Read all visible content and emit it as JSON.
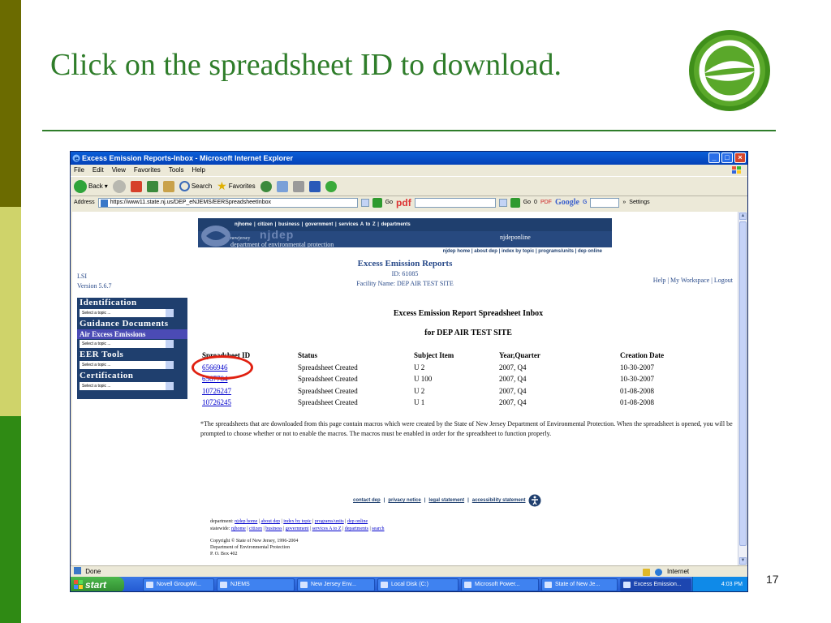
{
  "slide": {
    "title": "Click on the spreadsheet ID to download.",
    "number": "17"
  },
  "window": {
    "title": "Excess Emission Reports-Inbox - Microsoft Internet Explorer",
    "menu": [
      "File",
      "Edit",
      "View",
      "Favorites",
      "Tools",
      "Help"
    ],
    "toolbar": {
      "back": "Back",
      "search": "Search",
      "favorites": "Favorites"
    },
    "address": {
      "label": "Address",
      "url": "https://www11.state.nj.us/DEP_eNJEMS/EERSpreadsheetInbox",
      "go": "Go",
      "pdf_word": "pdf",
      "go2": "Go",
      "zero": "0",
      "pdf_btn": "PDF",
      "google": "Google",
      "google_g": "G",
      "settings": "Settings"
    },
    "status": {
      "done": "Done",
      "zone": "Internet"
    }
  },
  "page": {
    "banner": {
      "top_links": "njhome | citizen | business | government | services A to Z | departments",
      "newjersey": "newjersey",
      "njdep": "njdep",
      "dept": "department of environmental protection",
      "online": "njdeponline",
      "bottom_links": "njdep home | about dep | index by topic | programs/units | dep online"
    },
    "app_title": "Excess Emission Reports",
    "id_line": "ID: 61085",
    "facility_line": "Facility Name: DEP AIR TEST SITE",
    "lsi": "LSI",
    "version": "Version 5.6.7",
    "top_links": {
      "help": "Help",
      "workspace": "My Workspace",
      "logout": "Logout"
    },
    "nav": {
      "identification": "Identification",
      "guidance": "Guidance Documents",
      "air_excess": "Air Excess Emissions",
      "eer_tools": "EER Tools",
      "certification": "Certification",
      "select_placeholder": "Select a topic ..."
    },
    "inbox_title": "Excess Emission Report Spreadsheet Inbox",
    "inbox_subtitle": "for DEP AIR TEST SITE",
    "table": {
      "headers": [
        "Spreadsheet ID",
        "Status",
        "Subject Item",
        "Year,Quarter",
        "Creation Date"
      ],
      "rows": [
        {
          "id": "6566946",
          "status": "Spreadsheet Created",
          "subject": "U 2",
          "yq": "2007, Q4",
          "date": "10-30-2007"
        },
        {
          "id": "6567784",
          "status": "Spreadsheet Created",
          "subject": "U 100",
          "yq": "2007, Q4",
          "date": "10-30-2007"
        },
        {
          "id": "10726247",
          "status": "Spreadsheet Created",
          "subject": "U 2",
          "yq": "2007, Q4",
          "date": "01-08-2008"
        },
        {
          "id": "10726245",
          "status": "Spreadsheet Created",
          "subject": "U 1",
          "yq": "2007, Q4",
          "date": "01-08-2008"
        }
      ]
    },
    "footnote": "*The spreadsheets that are downloaded from this page contain macros which were created by the State of New Jersey Department of Environmental Protection. When the spreadsheet is opened, you will be prompted to choose whether or not to enable the macros. The macros must be enabled in order for the spreadsheet to function properly.",
    "footer": {
      "contact": "contact dep",
      "privacy": "privacy notice",
      "legal": "legal statement",
      "accessibility": "accessibility statement",
      "departments_label": "department:",
      "dept_links": [
        "njdep home",
        "about dep",
        "index by topic",
        "programs/units",
        "dep online"
      ],
      "statewide_label": "statewide:",
      "state_links": [
        "njhome",
        "citizen",
        "business",
        "government",
        "services A to Z",
        "departments",
        "search"
      ],
      "copyright_1": "Copyright © State of New Jersey, 1996-2004",
      "copyright_2": "Department of Environmental Protection",
      "copyright_3": "P. O. Box 402"
    }
  },
  "taskbar": {
    "start": "start",
    "tasks": [
      "Novell GroupWi...",
      "NJEMS",
      "New Jersey Env...",
      "Local Disk (C:)",
      "Microsoft Power...",
      "State of New Je...",
      "Excess Emission..."
    ],
    "clock": "4:03 PM"
  },
  "colors": {
    "slide_green": "#2f7d2a",
    "nj_navy": "#1f3f6e",
    "highlight_red": "#e02010",
    "link_blue": "#0000cc"
  }
}
